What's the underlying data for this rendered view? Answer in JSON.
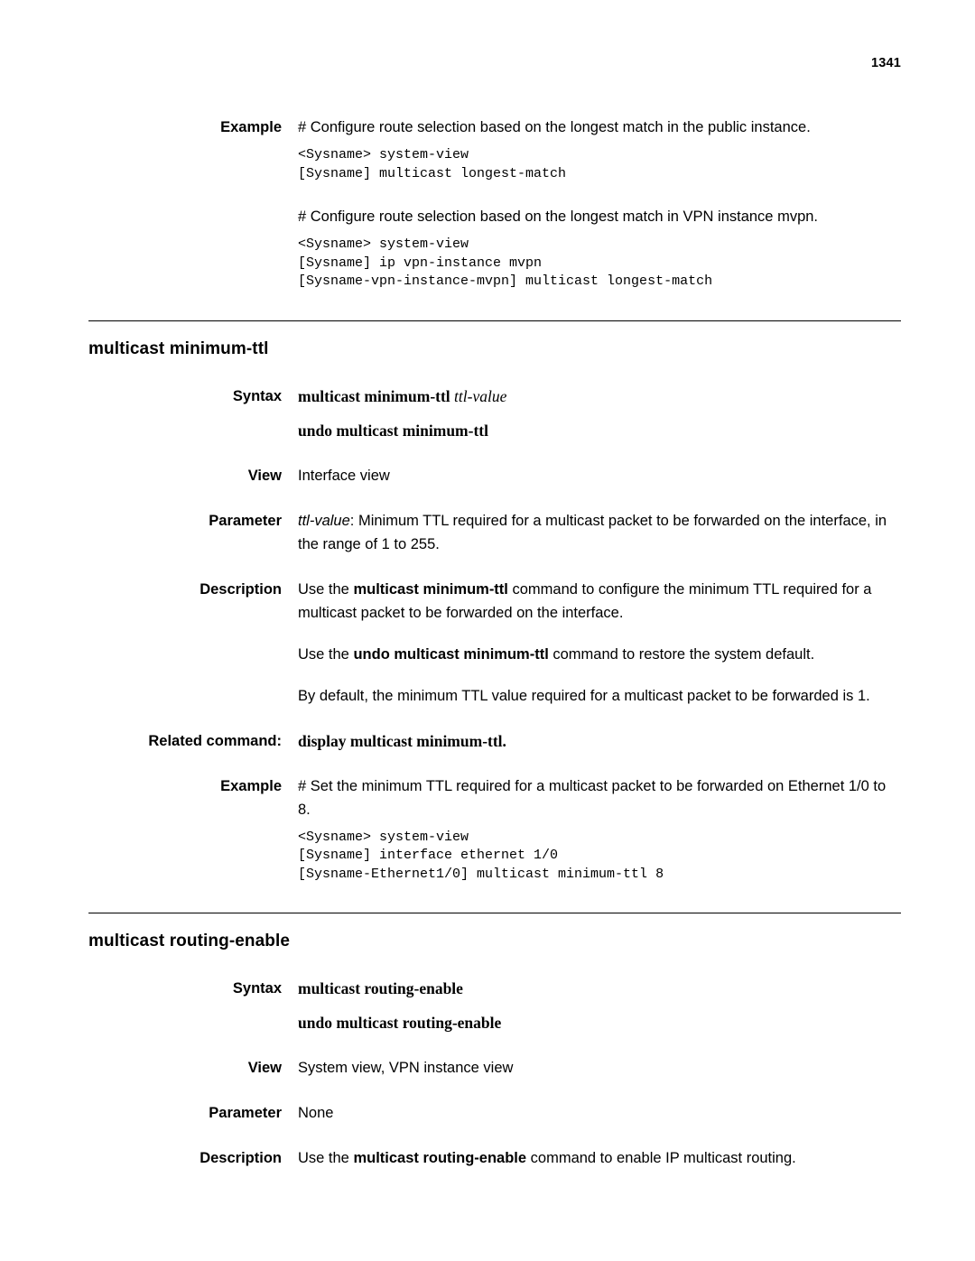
{
  "page": {
    "number": "1341"
  },
  "blocks": {
    "example1": {
      "label": "Example",
      "line1": "# Configure route selection based on the longest match in the public instance.",
      "code1": "<Sysname> system-view\n[Sysname] multicast longest-match",
      "line2": "# Configure route selection based on the longest match in VPN instance mvpn.",
      "code2": "<Sysname> system-view\n[Sysname] ip vpn-instance mvpn\n[Sysname-vpn-instance-mvpn] multicast longest-match"
    },
    "section_minimum_ttl": {
      "title": "multicast minimum-ttl",
      "syntax_label": "Syntax",
      "syntax_cmd": "multicast minimum-ttl ",
      "syntax_arg": "ttl-value",
      "syntax_undo": "undo multicast minimum-ttl",
      "view_label": "View",
      "view_value": "Interface view",
      "parameter_label": "Parameter",
      "parameter_value_italic": "ttl-value",
      "parameter_value_rest": ": Minimum TTL required for a multicast packet to be forwarded on the interface, in the range of 1 to 255.",
      "description_label": "Description",
      "desc_p1_a": "Use the ",
      "desc_p1_b": "multicast minimum-ttl",
      "desc_p1_c": " command to configure the minimum TTL required for a multicast packet to be forwarded on the interface.",
      "desc_p2_a": "Use the ",
      "desc_p2_b": "undo multicast minimum-ttl",
      "desc_p2_c": " command to restore the system default.",
      "desc_p3": "By default, the minimum TTL value required for a multicast packet to be forwarded is 1.",
      "related_label": "Related command:",
      "related_cmd": "display multicast minimum-ttl",
      "related_period": ".",
      "example_label": "Example",
      "example_line": "# Set the minimum TTL required for a multicast packet to be forwarded on Ethernet 1/0 to 8.",
      "example_code": "<Sysname> system-view\n[Sysname] interface ethernet 1/0\n[Sysname-Ethernet1/0] multicast minimum-ttl 8"
    },
    "section_routing_enable": {
      "title": "multicast routing-enable",
      "syntax_label": "Syntax",
      "syntax_cmd": "multicast routing-enable",
      "syntax_undo": "undo multicast routing-enable",
      "view_label": "View",
      "view_value": "System view, VPN instance view",
      "parameter_label": "Parameter",
      "parameter_value": "None",
      "description_label": "Description",
      "desc_a": "Use the ",
      "desc_b": "multicast routing-enable",
      "desc_c": " command to enable IP multicast routing."
    }
  }
}
